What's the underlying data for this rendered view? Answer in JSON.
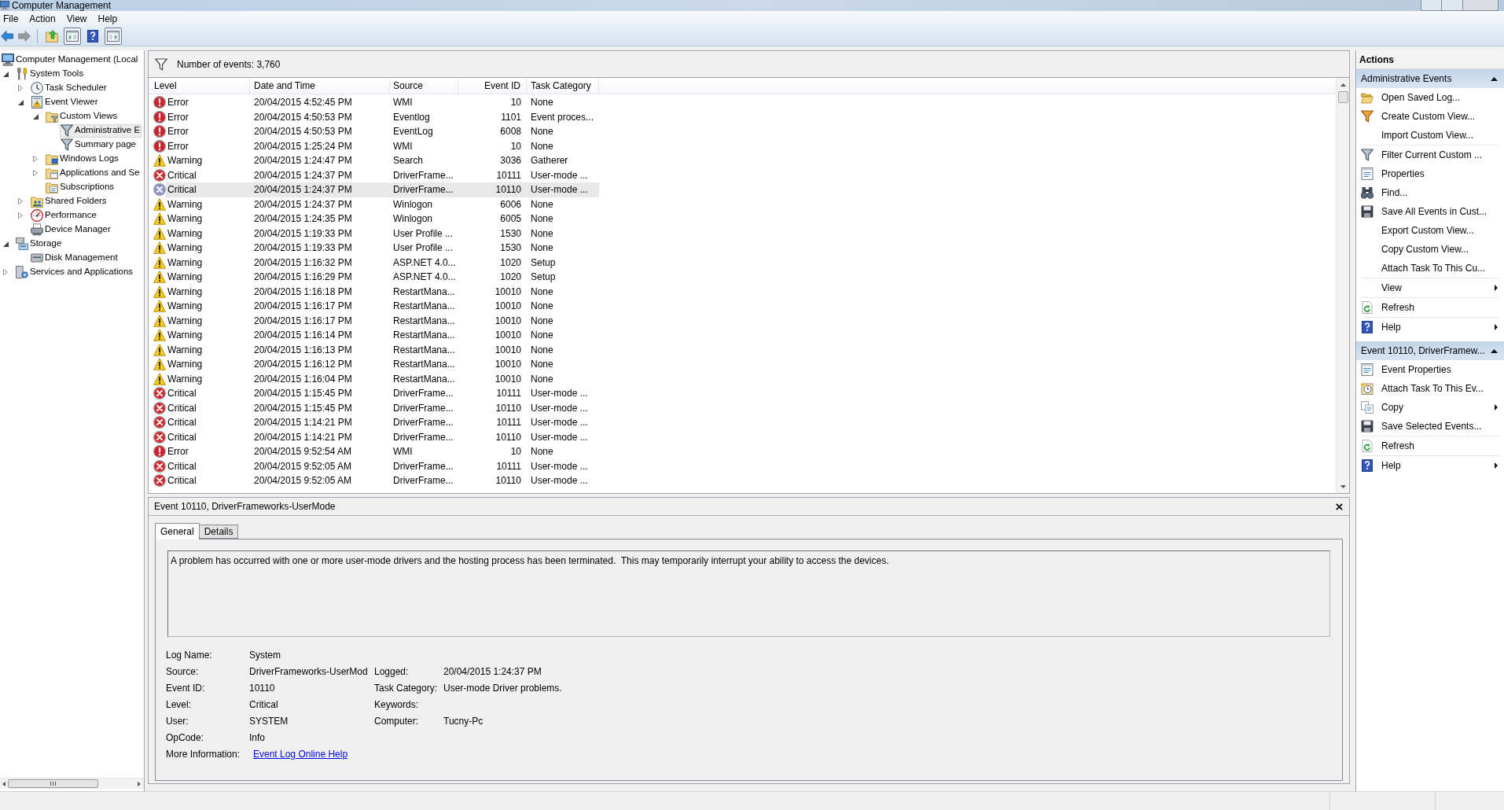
{
  "window": {
    "title": "Computer Management"
  },
  "menu": [
    "File",
    "Action",
    "View",
    "Help"
  ],
  "toolbar": [
    {
      "pressed": false,
      "disabled": false
    },
    {
      "pressed": false,
      "disabled": true
    },
    {
      "pressed": false,
      "disabled": false
    },
    {
      "pressed": true,
      "disabled": false
    },
    {
      "pressed": false,
      "disabled": false
    },
    {
      "pressed": true,
      "disabled": false
    }
  ],
  "tree": [
    {
      "label": "Computer Management (Local",
      "selected": false,
      "children": [
        {
          "label": "System Tools",
          "expanded": true,
          "selected": false,
          "children": [
            {
              "label": "Task Scheduler",
              "expanded": false,
              "selected": false
            },
            {
              "label": "Event Viewer",
              "expanded": true,
              "selected": false,
              "children": [
                {
                  "label": "Custom Views",
                  "expanded": true,
                  "selected": false,
                  "children": [
                    {
                      "label": "Administrative E",
                      "selected": true
                    },
                    {
                      "label": "Summary page",
                      "selected": false
                    }
                  ]
                },
                {
                  "label": "Windows Logs",
                  "expanded": false,
                  "selected": false
                },
                {
                  "label": "Applications and Se",
                  "expanded": false,
                  "selected": false
                },
                {
                  "label": "Subscriptions",
                  "selected": false
                }
              ]
            },
            {
              "label": "Shared Folders",
              "expanded": false,
              "selected": false
            },
            {
              "label": "Performance",
              "expanded": false,
              "selected": false
            },
            {
              "label": "Device Manager",
              "selected": false
            }
          ]
        },
        {
          "label": "Storage",
          "expanded": true,
          "selected": false,
          "children": [
            {
              "label": "Disk Management",
              "selected": false
            }
          ]
        },
        {
          "label": "Services and Applications",
          "expanded": false,
          "selected": false
        }
      ]
    }
  ],
  "events": {
    "count_label": "Number of events: 3,760",
    "columns": [
      "Level",
      "Date and Time",
      "Source",
      "Event ID",
      "Task Category"
    ],
    "rows": [
      {
        "kind": "error",
        "severity": "Error",
        "date_time": "20/04/2015 4:52:45 PM",
        "source": "WMI",
        "event_id": "10",
        "task_category": "None",
        "selected": false
      },
      {
        "kind": "error",
        "severity": "Error",
        "date_time": "20/04/2015 4:50:53 PM",
        "source": "Eventlog",
        "event_id": "1101",
        "task_category": "Event proces...",
        "selected": false
      },
      {
        "kind": "error",
        "severity": "Error",
        "date_time": "20/04/2015 4:50:53 PM",
        "source": "EventLog",
        "event_id": "6008",
        "task_category": "None",
        "selected": false
      },
      {
        "kind": "error",
        "severity": "Error",
        "date_time": "20/04/2015 1:25:24 PM",
        "source": "WMI",
        "event_id": "10",
        "task_category": "None",
        "selected": false
      },
      {
        "kind": "warning",
        "severity": "Warning",
        "date_time": "20/04/2015 1:24:47 PM",
        "source": "Search",
        "event_id": "3036",
        "task_category": "Gatherer",
        "selected": false
      },
      {
        "kind": "critical",
        "severity": "Critical",
        "date_time": "20/04/2015 1:24:37 PM",
        "source": "DriverFrame...",
        "event_id": "10111",
        "task_category": "User-mode ...",
        "selected": false
      },
      {
        "kind": "critical",
        "severity": "Critical",
        "date_time": "20/04/2015 1:24:37 PM",
        "source": "DriverFrame...",
        "event_id": "10110",
        "task_category": "User-mode ...",
        "selected": true
      },
      {
        "kind": "warning",
        "severity": "Warning",
        "date_time": "20/04/2015 1:24:37 PM",
        "source": "Winlogon",
        "event_id": "6006",
        "task_category": "None",
        "selected": false
      },
      {
        "kind": "warning",
        "severity": "Warning",
        "date_time": "20/04/2015 1:24:35 PM",
        "source": "Winlogon",
        "event_id": "6005",
        "task_category": "None",
        "selected": false
      },
      {
        "kind": "warning",
        "severity": "Warning",
        "date_time": "20/04/2015 1:19:33 PM",
        "source": "User Profile ...",
        "event_id": "1530",
        "task_category": "None",
        "selected": false
      },
      {
        "kind": "warning",
        "severity": "Warning",
        "date_time": "20/04/2015 1:19:33 PM",
        "source": "User Profile ...",
        "event_id": "1530",
        "task_category": "None",
        "selected": false
      },
      {
        "kind": "warning",
        "severity": "Warning",
        "date_time": "20/04/2015 1:16:32 PM",
        "source": "ASP.NET 4.0...",
        "event_id": "1020",
        "task_category": "Setup",
        "selected": false
      },
      {
        "kind": "warning",
        "severity": "Warning",
        "date_time": "20/04/2015 1:16:29 PM",
        "source": "ASP.NET 4.0...",
        "event_id": "1020",
        "task_category": "Setup",
        "selected": false
      },
      {
        "kind": "warning",
        "severity": "Warning",
        "date_time": "20/04/2015 1:16:18 PM",
        "source": "RestartMana...",
        "event_id": "10010",
        "task_category": "None",
        "selected": false
      },
      {
        "kind": "warning",
        "severity": "Warning",
        "date_time": "20/04/2015 1:16:17 PM",
        "source": "RestartMana...",
        "event_id": "10010",
        "task_category": "None",
        "selected": false
      },
      {
        "kind": "warning",
        "severity": "Warning",
        "date_time": "20/04/2015 1:16:17 PM",
        "source": "RestartMana...",
        "event_id": "10010",
        "task_category": "None",
        "selected": false
      },
      {
        "kind": "warning",
        "severity": "Warning",
        "date_time": "20/04/2015 1:16:14 PM",
        "source": "RestartMana...",
        "event_id": "10010",
        "task_category": "None",
        "selected": false
      },
      {
        "kind": "warning",
        "severity": "Warning",
        "date_time": "20/04/2015 1:16:13 PM",
        "source": "RestartMana...",
        "event_id": "10010",
        "task_category": "None",
        "selected": false
      },
      {
        "kind": "warning",
        "severity": "Warning",
        "date_time": "20/04/2015 1:16:12 PM",
        "source": "RestartMana...",
        "event_id": "10010",
        "task_category": "None",
        "selected": false
      },
      {
        "kind": "warning",
        "severity": "Warning",
        "date_time": "20/04/2015 1:16:04 PM",
        "source": "RestartMana...",
        "event_id": "10010",
        "task_category": "None",
        "selected": false
      },
      {
        "kind": "critical",
        "severity": "Critical",
        "date_time": "20/04/2015 1:15:45 PM",
        "source": "DriverFrame...",
        "event_id": "10111",
        "task_category": "User-mode ...",
        "selected": false
      },
      {
        "kind": "critical",
        "severity": "Critical",
        "date_time": "20/04/2015 1:15:45 PM",
        "source": "DriverFrame...",
        "event_id": "10110",
        "task_category": "User-mode ...",
        "selected": false
      },
      {
        "kind": "critical",
        "severity": "Critical",
        "date_time": "20/04/2015 1:14:21 PM",
        "source": "DriverFrame...",
        "event_id": "10111",
        "task_category": "User-mode ...",
        "selected": false
      },
      {
        "kind": "critical",
        "severity": "Critical",
        "date_time": "20/04/2015 1:14:21 PM",
        "source": "DriverFrame...",
        "event_id": "10110",
        "task_category": "User-mode ...",
        "selected": false
      },
      {
        "kind": "error",
        "severity": "Error",
        "date_time": "20/04/2015 9:52:54 AM",
        "source": "WMI",
        "event_id": "10",
        "task_category": "None",
        "selected": false
      },
      {
        "kind": "critical",
        "severity": "Critical",
        "date_time": "20/04/2015 9:52:05 AM",
        "source": "DriverFrame...",
        "event_id": "10111",
        "task_category": "User-mode ...",
        "selected": false
      },
      {
        "kind": "critical",
        "severity": "Critical",
        "date_time": "20/04/2015 9:52:05 AM",
        "source": "DriverFrame...",
        "event_id": "10110",
        "task_category": "User-mode ...",
        "selected": false
      }
    ]
  },
  "event_detail": {
    "title": "Event 10110, DriverFrameworks-UserMode",
    "tabs": [
      {
        "label": "General",
        "selected": true
      },
      {
        "label": "Details",
        "selected": false
      }
    ],
    "description": "A problem has occurred with one or more user-mode drivers and the hosting process has been terminated.  This may temporarily interrupt your ability to access the devices.",
    "field_rows": [
      [
        {
          "label": "Log Name:",
          "value": "System"
        }
      ],
      [
        {
          "label": "Source:",
          "value": "DriverFrameworks-UserMod"
        },
        {
          "label": "Logged:",
          "value": "20/04/2015 1:24:37 PM"
        }
      ],
      [
        {
          "label": "Event ID:",
          "value": "10110"
        },
        {
          "label": "Task Category:",
          "value": "User-mode Driver problems."
        }
      ],
      [
        {
          "label": "Level:",
          "value": "Critical"
        },
        {
          "label": "Keywords:"
        }
      ],
      [
        {
          "label": "User:",
          "value": "SYSTEM"
        },
        {
          "label": "Computer:",
          "value": "Tucny-Pc"
        }
      ],
      [
        {
          "label": "OpCode:",
          "value": "Info"
        }
      ]
    ],
    "more_information": {
      "label": "More Information:",
      "link": "Event Log Online Help"
    }
  },
  "actions": {
    "title": "Actions",
    "sections": [
      {
        "title": "Administrative Events",
        "expanded": true,
        "groups": [
          [
            {
              "label": "Open Saved Log...",
              "submenu": false
            },
            {
              "label": "Create Custom View...",
              "submenu": false
            },
            {
              "label": "Import Custom View...",
              "submenu": false
            }
          ],
          [
            {
              "label": "Filter Current Custom ...",
              "submenu": false
            },
            {
              "label": "Properties",
              "submenu": false
            },
            {
              "label": "Find...",
              "submenu": false
            },
            {
              "label": "Save All Events in Cust...",
              "submenu": false
            },
            {
              "label": "Export Custom View...",
              "submenu": false
            },
            {
              "label": "Copy Custom View...",
              "submenu": false
            },
            {
              "label": "Attach Task To This Cu...",
              "submenu": false
            }
          ],
          [
            {
              "label": "View",
              "submenu": true
            }
          ],
          [
            {
              "label": "Refresh",
              "submenu": false
            }
          ],
          [
            {
              "label": "Help",
              "submenu": true
            }
          ]
        ]
      },
      {
        "title": "Event 10110, DriverFramew...",
        "expanded": true,
        "groups": [
          [
            {
              "label": "Event Properties",
              "submenu": false
            },
            {
              "label": "Attach Task To This Ev...",
              "submenu": false
            },
            {
              "label": "Copy",
              "submenu": true
            },
            {
              "label": "Save Selected Events...",
              "submenu": false
            }
          ],
          [
            {
              "label": "Refresh",
              "submenu": false
            }
          ],
          [
            {
              "label": "Help",
              "submenu": true
            }
          ]
        ]
      }
    ]
  }
}
